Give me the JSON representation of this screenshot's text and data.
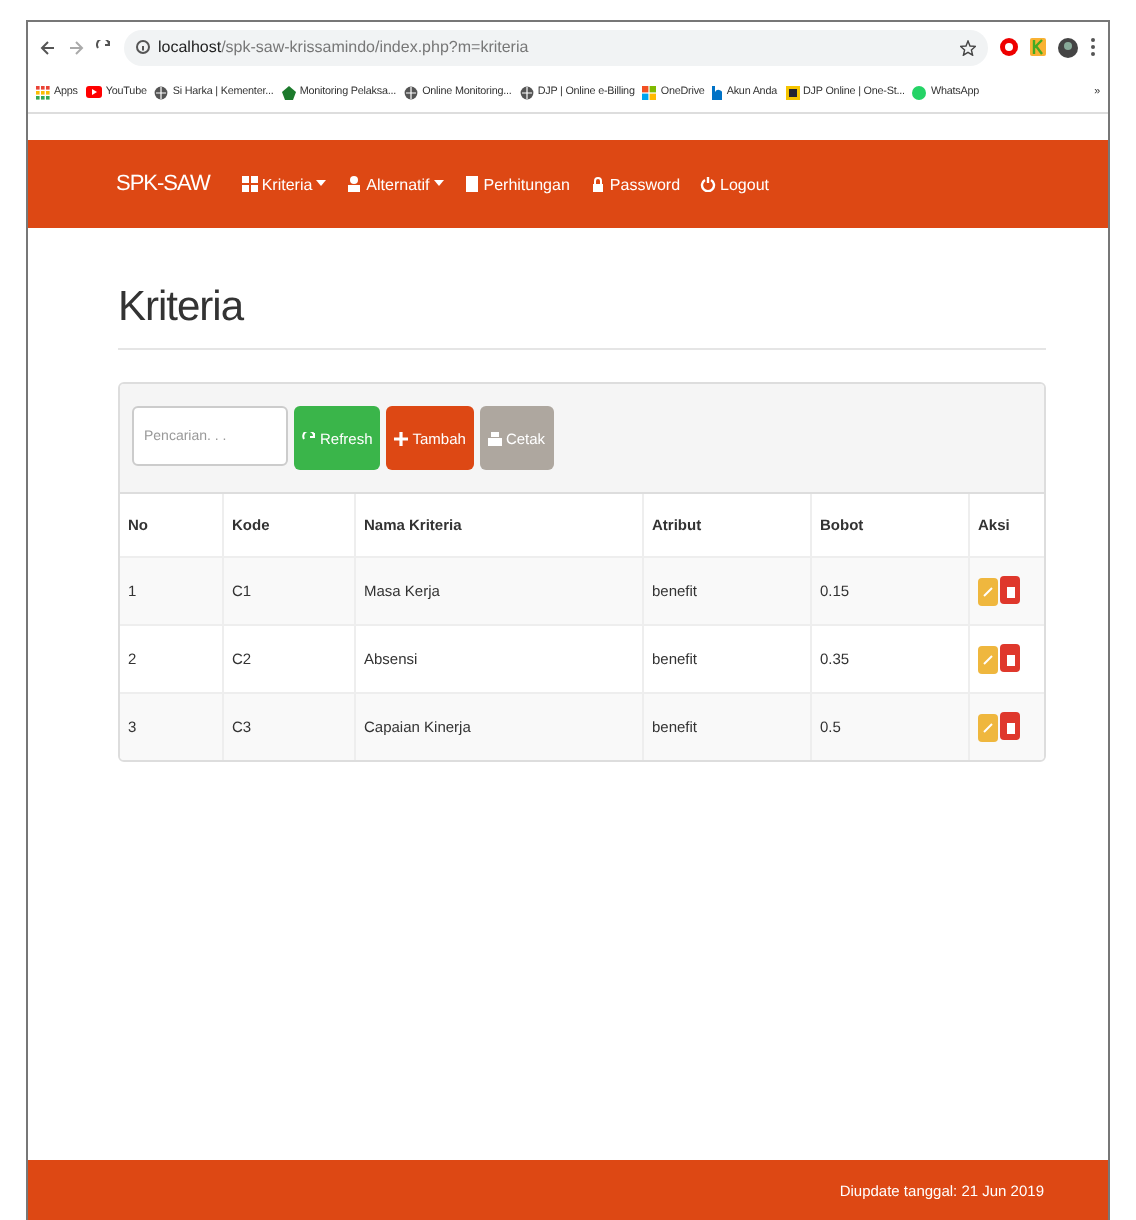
{
  "browser": {
    "url_host": "localhost",
    "url_path": "/spk-saw-krissamindo/index.php?m=kriteria",
    "bookmarks": [
      {
        "label": "Apps",
        "kind": "apps"
      },
      {
        "label": "YouTube",
        "kind": "youtube"
      },
      {
        "label": "Si Harka | Kementer...",
        "kind": "globe"
      },
      {
        "label": "Monitoring Pelaksa...",
        "kind": "emblem"
      },
      {
        "label": "Online Monitoring...",
        "kind": "globe"
      },
      {
        "label": "DJP | Online e-Billing",
        "kind": "globe"
      },
      {
        "label": "OneDrive",
        "kind": "windows"
      },
      {
        "label": "Akun Anda",
        "kind": "b"
      },
      {
        "label": "DJP Online | One-St...",
        "kind": "doc"
      },
      {
        "label": "WhatsApp",
        "kind": "whatsapp"
      }
    ],
    "more": "»"
  },
  "navbar": {
    "brand": "SPK-SAW",
    "items": [
      {
        "label": "Kriteria",
        "dropdown": true
      },
      {
        "label": "Alternatif",
        "dropdown": true
      },
      {
        "label": "Perhitungan",
        "dropdown": false
      },
      {
        "label": "Password",
        "dropdown": false
      },
      {
        "label": "Logout",
        "dropdown": false
      }
    ]
  },
  "page": {
    "title": "Kriteria"
  },
  "toolbar": {
    "search": {
      "placeholder": "Pencarian. . ."
    },
    "buttons": [
      {
        "label": "Refresh",
        "kind": "success"
      },
      {
        "label": "Tambah",
        "kind": "danger"
      },
      {
        "label": "Cetak",
        "kind": "default"
      }
    ]
  },
  "table": {
    "columns": [
      "No",
      "Kode",
      "Nama Kriteria",
      "Atribut",
      "Bobot",
      "Aksi"
    ],
    "rows": [
      {
        "no": "1",
        "kode": "C1",
        "nama": "Masa Kerja",
        "atribut": "benefit",
        "bobot": "0.15"
      },
      {
        "no": "2",
        "kode": "C2",
        "nama": "Absensi",
        "atribut": "benefit",
        "bobot": "0.35"
      },
      {
        "no": "3",
        "kode": "C3",
        "nama": "Capaian Kinerja",
        "atribut": "benefit",
        "bobot": "0.5"
      }
    ]
  },
  "footer": {
    "text": "Diupdate tanggal: 21 Jun 2019"
  }
}
